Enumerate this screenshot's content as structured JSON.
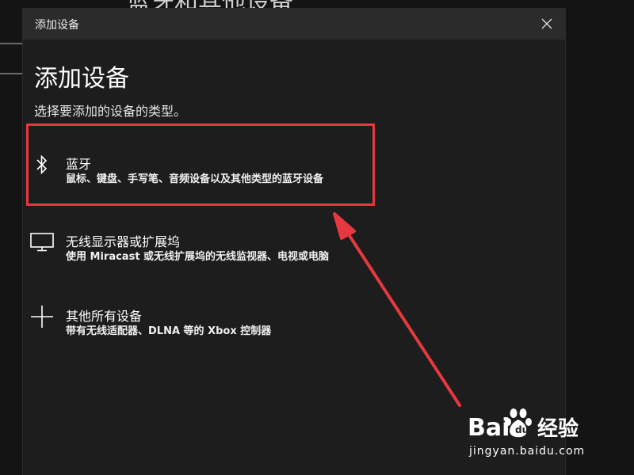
{
  "background_window": {
    "heading": "蓝牙和其他设备"
  },
  "dialog": {
    "title": "添加设备",
    "heading": "添加设备",
    "subtitle": "选择要添加的设备的类型。",
    "options": [
      {
        "icon": "bluetooth-icon",
        "title": "蓝牙",
        "description": "鼠标、键盘、手写笔、音频设备以及其他类型的蓝牙设备"
      },
      {
        "icon": "monitor-icon",
        "title": "无线显示器或扩展坞",
        "description": "使用 Miracast 或无线扩展坞的无线监视器、电视或电脑"
      },
      {
        "icon": "plus-icon",
        "title": "其他所有设备",
        "description": "带有无线适配器、DLNA 等的 Xbox 控制器"
      }
    ]
  },
  "annotation": {
    "color": "#e5393f"
  },
  "watermark": {
    "brand": "Bai 经验",
    "url": "jingyan.baidu.com"
  }
}
